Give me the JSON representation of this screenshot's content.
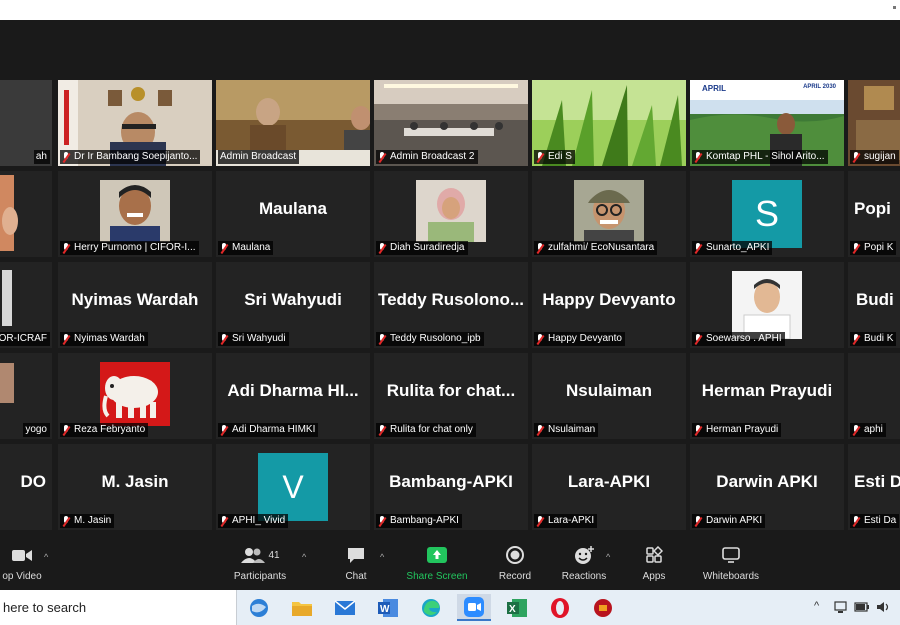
{
  "tiles": [
    {
      "label": "ah",
      "name": ""
    },
    {
      "label": "Dr Ir Bambang Soepijanto...",
      "name": ""
    },
    {
      "label": "Admin Broadcast",
      "name": ""
    },
    {
      "label": "Admin Broadcast 2",
      "name": ""
    },
    {
      "label": "Edi S",
      "name": ""
    },
    {
      "label": "Komtap PHL - Sihol Arito...",
      "name": ""
    },
    {
      "label": "sugijan",
      "name": ""
    },
    {
      "label": "",
      "name": ""
    },
    {
      "label": "Herry Purnomo | CIFOR-I...",
      "name": ""
    },
    {
      "label": "Maulana",
      "name": "Maulana"
    },
    {
      "label": "Diah Suradiredja",
      "name": ""
    },
    {
      "label": "zulfahmi/ EcoNusantara",
      "name": ""
    },
    {
      "label": "Sunarto_APKI",
      "name": "S"
    },
    {
      "label": "Popi K",
      "name": "Popi"
    },
    {
      "label": "OR-ICRAF",
      "name": ""
    },
    {
      "label": "Nyimas Wardah",
      "name": "Nyimas Wardah"
    },
    {
      "label": "Sri Wahyudi",
      "name": "Sri Wahyudi"
    },
    {
      "label": "Teddy Rusolono_ipb",
      "name": "Teddy Rusolono..."
    },
    {
      "label": "Happy Devyanto",
      "name": "Happy Devyanto"
    },
    {
      "label": "Soewarso . APHI",
      "name": ""
    },
    {
      "label": "Budi K",
      "name": "Budi"
    },
    {
      "label": "yogo",
      "name": ""
    },
    {
      "label": "Reza Febryanto",
      "name": ""
    },
    {
      "label": "Adi Dharma HIMKI",
      "name": "Adi Dharma HI..."
    },
    {
      "label": "Rulita for chat only",
      "name": "Rulita for chat..."
    },
    {
      "label": "Nsulaiman",
      "name": "Nsulaiman"
    },
    {
      "label": "Herman Prayudi",
      "name": "Herman Prayudi"
    },
    {
      "label": "aphi",
      "name": ""
    },
    {
      "label": "",
      "name": "DO"
    },
    {
      "label": "M. Jasin",
      "name": "M. Jasin"
    },
    {
      "label": "APHI_ Vivid",
      "name": "V"
    },
    {
      "label": "Bambang-APKI",
      "name": "Bambang-APKI"
    },
    {
      "label": "Lara-APKI",
      "name": "Lara-APKI"
    },
    {
      "label": "Darwin APKI",
      "name": "Darwin APKI"
    },
    {
      "label": "Esti Da",
      "name": "Esti D"
    }
  ],
  "toolbar": {
    "video": "op Video",
    "participants": "Participants",
    "participants_count": "41",
    "chat": "Chat",
    "share": "Share Screen",
    "record": "Record",
    "reactions": "Reactions",
    "apps": "Apps",
    "whiteboards": "Whiteboards"
  },
  "taskbar": {
    "search_text": "here to search"
  },
  "colors": {
    "share": "#22c55e",
    "avatar_teal": "#149aa6",
    "active_border": "#c6e05a",
    "muted_mic": "#e02828"
  },
  "logos": {
    "april_left": "APRIL",
    "april_right": "APRIL 2030"
  }
}
